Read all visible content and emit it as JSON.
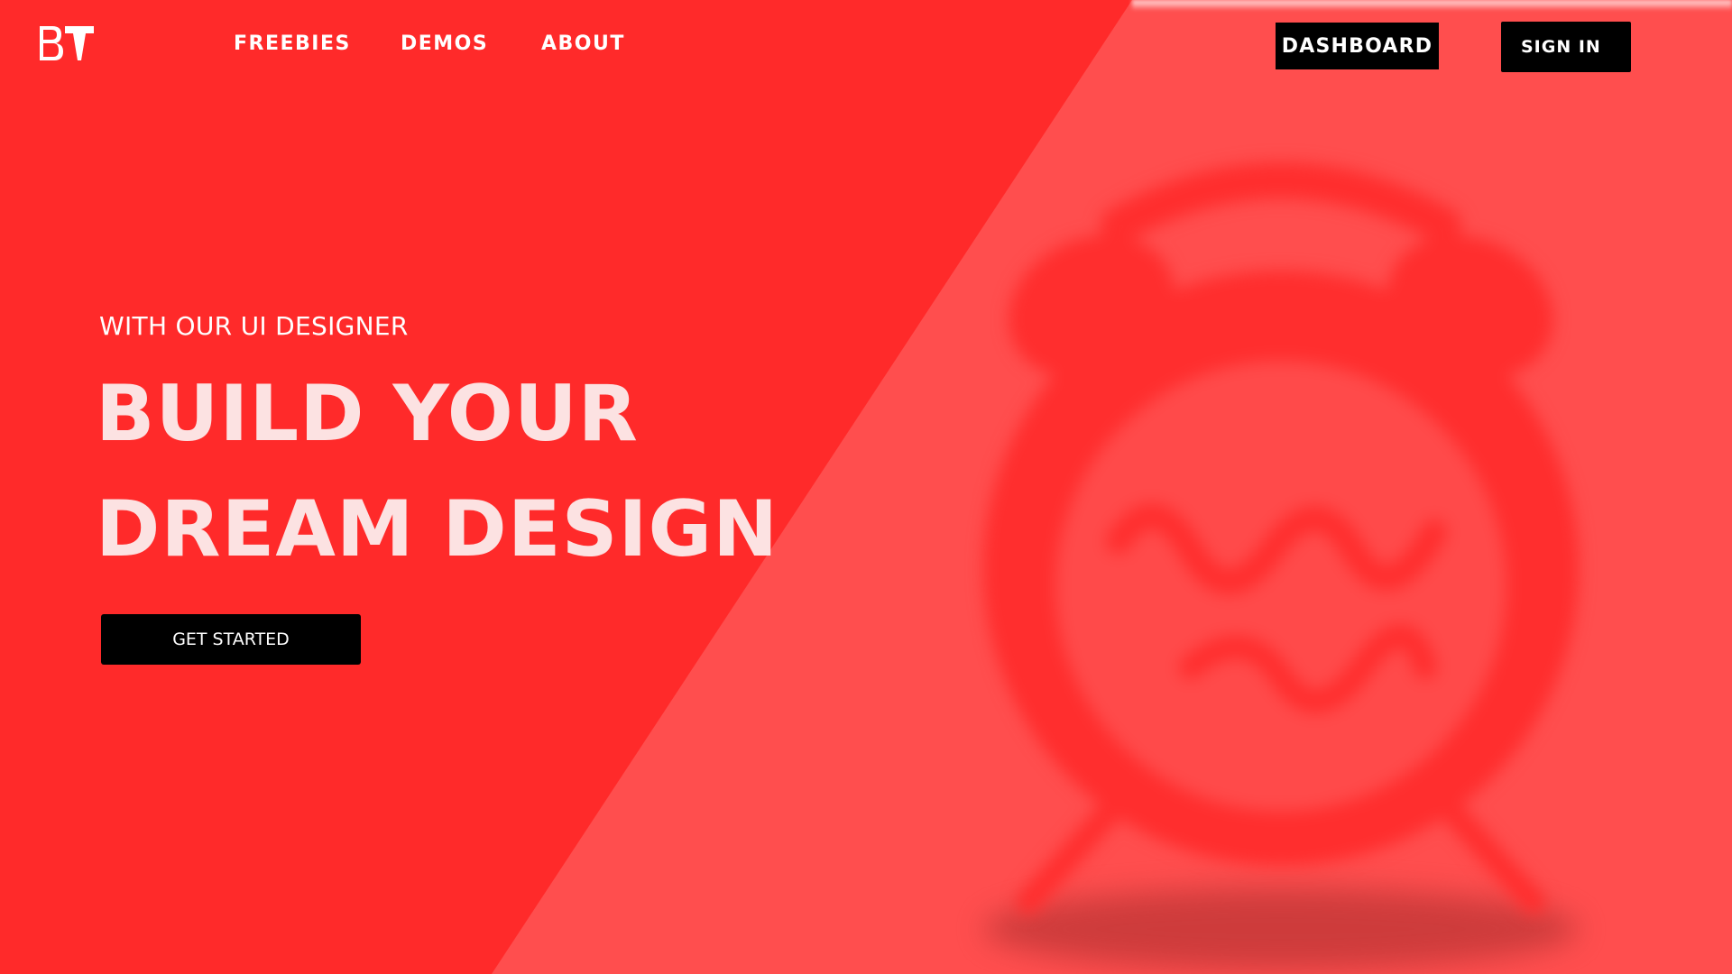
{
  "brand": {
    "logo_text": "BT"
  },
  "nav": {
    "links": [
      {
        "label": "FREEBIES"
      },
      {
        "label": "DEMOS"
      },
      {
        "label": "ABOUT"
      }
    ],
    "dashboard_label": "DASHBOARD",
    "signin_label": "SIGN IN"
  },
  "hero": {
    "subtitle": "WITH OUR UI DESIGNER",
    "headline_line1": "BUILD YOUR",
    "headline_line2": "DREAM DESIGN",
    "cta_label": "GET STARTED"
  },
  "illustration": {
    "name": "alarm-clock-illustration"
  },
  "colors": {
    "left_background": "#FF2A2A",
    "right_background": "#FF4E4E",
    "button_background": "#000000",
    "headline_text": "#FCE2E2",
    "clock": "#FF2E2E"
  }
}
